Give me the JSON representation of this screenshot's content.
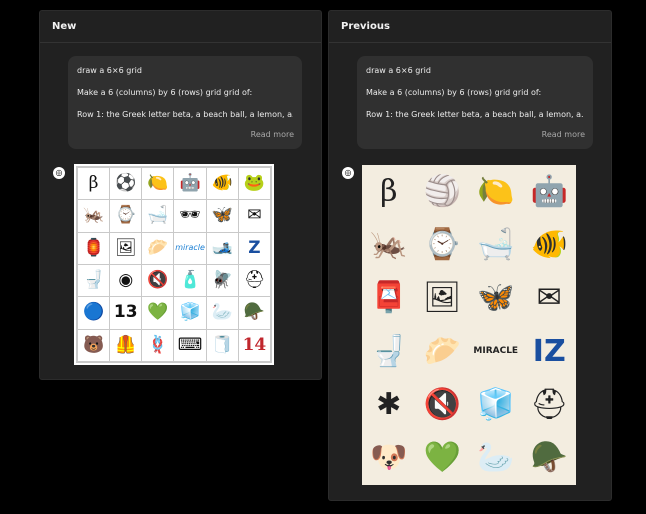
{
  "panels": {
    "new": {
      "title": "New",
      "message": {
        "line1": "draw a 6×6 grid",
        "line2": "Make a 6 (columns) by 6 (rows) grid grid of:",
        "line3": "Row 1: the Greek letter beta, a beach ball, a lemon, a...",
        "read_more": "Read more"
      },
      "avatar_icon": "openai-logo-icon",
      "grid": [
        [
          "β",
          "⚽",
          "🍋",
          "🤖",
          "🐠",
          "🐸"
        ],
        [
          "🦗",
          "⌚",
          "🛁",
          "🕶",
          "🦋",
          "✉"
        ],
        [
          "🏮",
          "🖼",
          "🥟",
          "miracle",
          "🎿",
          "Z"
        ],
        [
          "🚽",
          "◉",
          "🔇",
          "🧴",
          "🪰",
          "⛑"
        ],
        [
          "🔵",
          "13",
          "💚",
          "🧊",
          "🦢",
          "🪖"
        ],
        [
          "🐻",
          "🦺",
          "🪢",
          "⌨",
          "🧻",
          "14"
        ]
      ]
    },
    "previous": {
      "title": "Previous",
      "message": {
        "line1": "draw a 6×6 grid",
        "line2": "Make a 6 (columns) by 6 (rows) grid grid of:",
        "line3": "Row 1: the Greek letter beta, a beach ball, a lemon, a...",
        "read_more": "Read more"
      },
      "avatar_icon": "openai-logo-icon",
      "grid": [
        [
          "β",
          "🏐",
          "🍋",
          "🤖"
        ],
        [
          "🦗",
          "⌚",
          "🛁",
          "🐠"
        ],
        [
          "📮",
          "🖼",
          "🦋",
          "✉"
        ],
        [
          "🚽",
          "🥟",
          "MIRACLE",
          "IZ"
        ],
        [
          "✱",
          "🔇",
          "🧊",
          "⛑"
        ],
        [
          "🐶",
          "💚",
          "🦢",
          "🪖"
        ]
      ]
    }
  }
}
